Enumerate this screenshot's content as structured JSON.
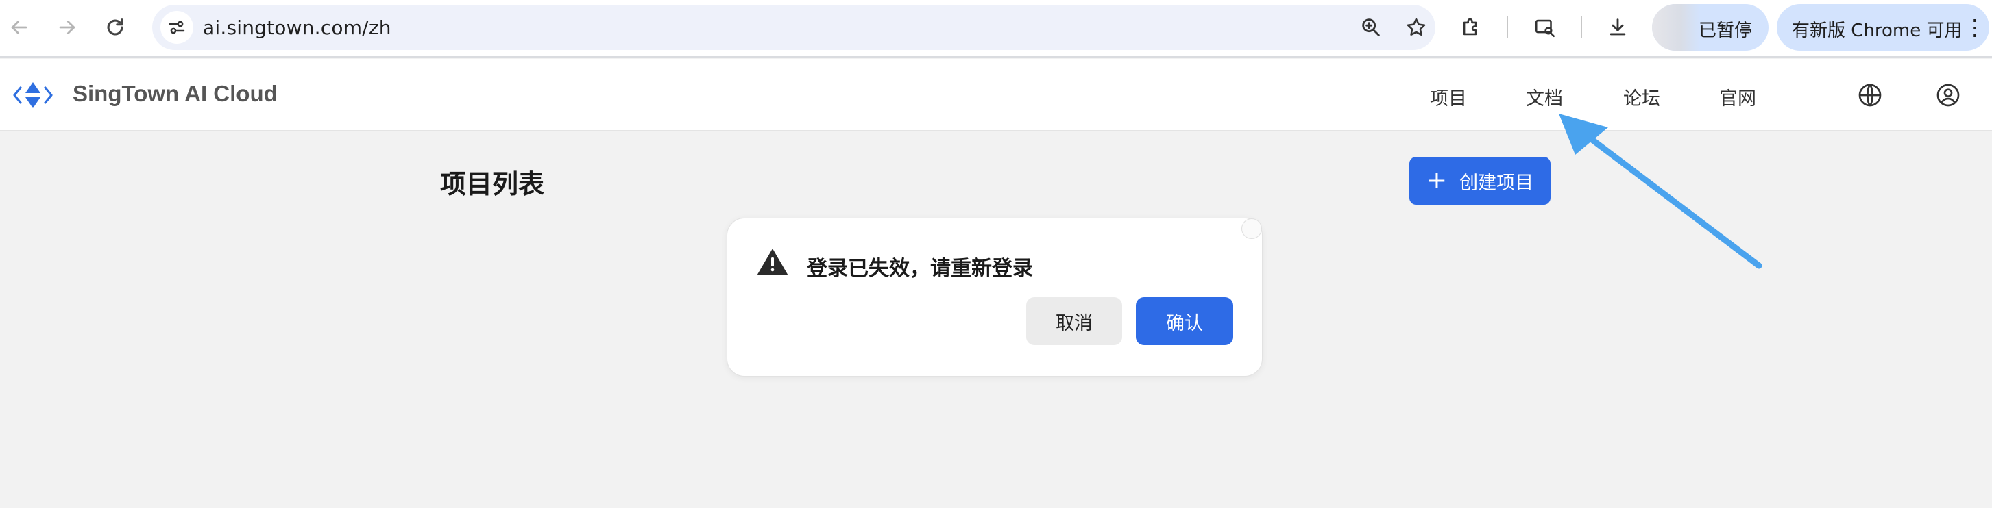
{
  "browser": {
    "url": "ai.singtown.com/zh",
    "profile_status": "已暂停",
    "update_label": "有新版 Chrome 可用",
    "menu_glyph": "⋮",
    "icons": [
      "back-icon",
      "forward-icon",
      "reload-icon",
      "site-info-icon",
      "zoom-icon",
      "bookmark-star-icon",
      "extensions-icon",
      "search-tab-icon",
      "download-icon",
      "more-menu-icon"
    ]
  },
  "header": {
    "brand": "SingTown AI Cloud",
    "nav": [
      {
        "label": "项目"
      },
      {
        "label": "文档"
      },
      {
        "label": "论坛"
      },
      {
        "label": "官网"
      }
    ],
    "icons": [
      "globe-icon",
      "user-account-icon"
    ]
  },
  "main": {
    "title": "项目列表",
    "create_button": {
      "icon": "+",
      "label": "创建项目"
    }
  },
  "dialog": {
    "message": "登录已失效，请重新登录",
    "cancel_label": "取消",
    "confirm_label": "确认",
    "icon": "warning-triangle-icon"
  },
  "colors": {
    "primary": "#2e6be6",
    "page_bg": "#f2f2f2",
    "annotation_arrow": "#4aa3ee",
    "logo_blue": "#2f6fe0"
  }
}
